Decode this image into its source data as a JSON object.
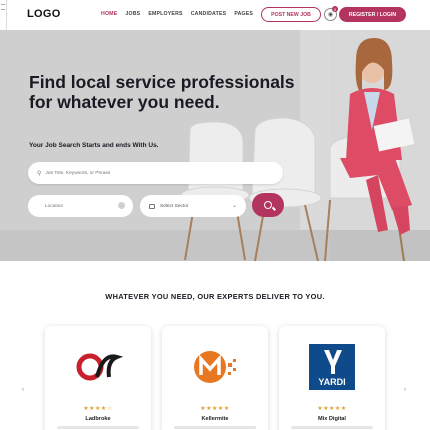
{
  "header": {
    "logo": "LOGO",
    "nav": [
      "HOME",
      "JOBS",
      "EMPLOYERS",
      "CANDIDATES",
      "PAGES"
    ],
    "active_nav": "HOME",
    "post_job": "POST NEW JOB",
    "notification_count": "0",
    "register_login": "REGISTER / LOGIN"
  },
  "hero": {
    "title": "Find local service professionals for whatever you need.",
    "subtitle": "Your Job Search Starts and ends With Us.",
    "search_placeholder": "Job Title, Keywords, or Phrase",
    "location_placeholder": "Location",
    "sector_label": "Select Sector"
  },
  "section": {
    "title": "WHATEVER YOU NEED, OUR EXPERTS DELIVER TO YOU."
  },
  "companies": [
    {
      "name": "Ladbroke",
      "stars": "★★★★☆",
      "logo_icon": "ladbroke-logo-icon"
    },
    {
      "name": "Kellermite",
      "stars": "★★★★★",
      "logo_icon": "kellermite-logo-icon"
    },
    {
      "name": "Mix Digital",
      "stars": "★★★★★",
      "logo_icon": "yardi-logo-icon",
      "logo_text": "YARDI"
    }
  ],
  "colors": {
    "accent": "#b3345f",
    "star": "#e0a030"
  }
}
